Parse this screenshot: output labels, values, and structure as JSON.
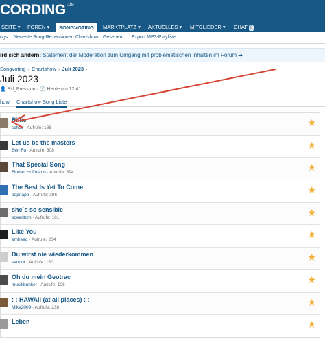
{
  "header": {
    "logo": "CORDING",
    "logo_suffix": ".de"
  },
  "nav": [
    {
      "label": "SEITE",
      "active": false
    },
    {
      "label": "FOREN",
      "active": false
    },
    {
      "label": "SONGVOTING",
      "active": true
    },
    {
      "label": "MARKTPLATZ",
      "active": false
    },
    {
      "label": "AKTUELLES",
      "active": false
    },
    {
      "label": "MITGLIEDER",
      "active": false
    },
    {
      "label": "CHAT",
      "active": false,
      "badge": "0"
    }
  ],
  "subnav": [
    "ngs",
    "Neueste Song-Rezensionen",
    "Chartshow",
    "Gesehen",
    "Export MP3-Playliste"
  ],
  "notice": {
    "pre": "ird sich ändern:",
    "link": "Statement der Moderation zum Umgang mit problematischen Inhalten im Forum ➔"
  },
  "breadcrumb": [
    "Songvoting",
    "Chartshow",
    "Juli 2023"
  ],
  "page_title": "Juli 2023",
  "meta": {
    "author": "Bill_Presston",
    "time": "Heute um 12:41"
  },
  "tabs": [
    {
      "label": "how",
      "active": false
    },
    {
      "label": "Chartshow Song Liste",
      "active": true
    }
  ],
  "songs": [
    {
      "title": "Billie",
      "user": "schos",
      "views_label": "Aufrufe: 186",
      "thumb": "#8a7a6a"
    },
    {
      "title": "Let us be the masters",
      "user": "Ben Fu",
      "views_label": "Aufrufe: 308",
      "thumb": "#3a3a3a"
    },
    {
      "title": "That Special Song",
      "user": "Florian Hoffmann",
      "views_label": "Aufrufe: 394",
      "thumb": "#5b4a3c"
    },
    {
      "title": "The Best Is Yet To Come",
      "user": "popnapp",
      "views_label": "Aufrufe: 286",
      "thumb": "#2f6fb3"
    },
    {
      "title": "she`s so sensible",
      "user": "speedtom",
      "views_label": "Aufrufe: 161",
      "thumb": "#6c6c6c"
    },
    {
      "title": "Like You",
      "user": "emhead",
      "views_label": "Aufrufe: 264",
      "thumb": "#1e1e1e"
    },
    {
      "title": "Du wirst nie wiederkommen",
      "user": "sanoor",
      "views_label": "Aufrufe: 180",
      "thumb": "#cfcfcf"
    },
    {
      "title": "Oh du mein Geotrac",
      "user": "musikbunker",
      "views_label": "Aufrufe: 106",
      "thumb": "#4c4c4c"
    },
    {
      "title": ": : HAWAII (at all places) : :",
      "user": "Mike2009",
      "views_label": "Aufrufe: 238",
      "thumb": "#7a5a3a"
    },
    {
      "title": "Leben",
      "user": "",
      "views_label": "",
      "thumb": "#9a9a9a"
    }
  ],
  "colors": {
    "brand": "#185886",
    "star": "#f2b035",
    "arrow": "#d64535"
  }
}
